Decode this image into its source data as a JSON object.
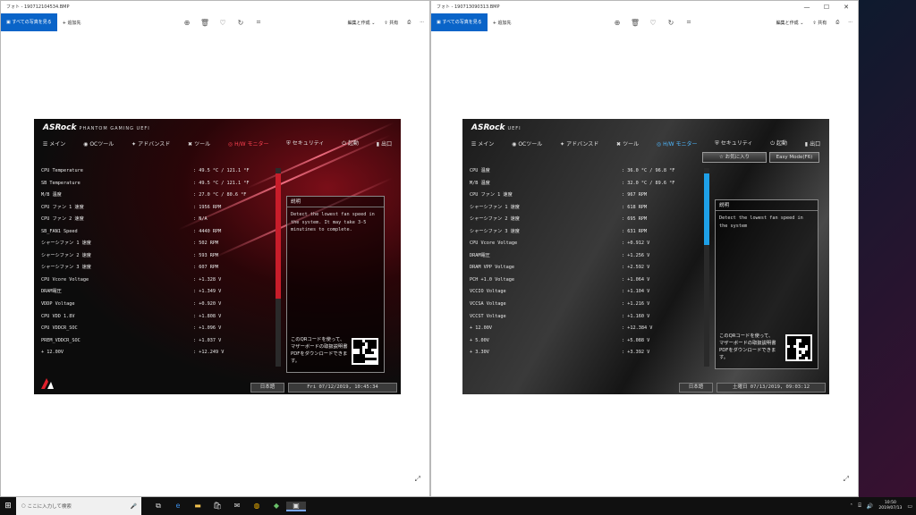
{
  "windows": [
    {
      "title": "フォト - 190712104534.BMP",
      "toolbar": {
        "all_photos": "すべての写真を見る",
        "add_to": "+ 追加先",
        "edit_create": "編集と作成",
        "share": "共有"
      }
    },
    {
      "title": "フォト - 190713090313.BMP",
      "toolbar": {
        "all_photos": "すべての写真を見る",
        "add_to": "+ 追加先",
        "edit_create": "編集と作成",
        "share": "共有"
      }
    }
  ],
  "uefi_left": {
    "logo": "ASRock",
    "logo_sub": "PHANTOM GAMING UEFI",
    "nav": [
      "メイン",
      "OCツール",
      "アドバンスド",
      "ツール",
      "H/W モニター",
      "セキュリティ",
      "起動",
      "出口"
    ],
    "rows": [
      {
        "label": "CPU Temperature",
        "value": ": 49.5 °C / 121.1 °F"
      },
      {
        "label": "SB Temperature",
        "value": ": 49.5 °C / 121.1 °F"
      },
      {
        "label": "M/B 温度",
        "value": ": 27.0 °C / 80.6 °F"
      },
      {
        "label": "CPU ファン 1 速度",
        "value": ": 1956 RPM"
      },
      {
        "label": "CPU ファン 2 速度",
        "value": ": N/A"
      },
      {
        "label": "SB_FAN1 Speed",
        "value": ": 4440 RPM"
      },
      {
        "label": "シャーシファン 1 速度",
        "value": ": 502 RPM"
      },
      {
        "label": "シャーシファン 2 速度",
        "value": ": 593 RPM"
      },
      {
        "label": "シャーシファン 3 速度",
        "value": ": 607 RPM"
      },
      {
        "label": "CPU Vcore Voltage",
        "value": ": +1.328 V"
      },
      {
        "label": "DRAM電圧",
        "value": ": +1.349 V"
      },
      {
        "label": "VDDP Voltage",
        "value": ": +0.920 V"
      },
      {
        "label": "CPU VDD 1.8V",
        "value": ": +1.808 V"
      },
      {
        "label": "CPU VDDCR_SOC",
        "value": ": +1.096 V"
      },
      {
        "label": "PREM_VDDCR_SOC",
        "value": ": +1.037 V"
      },
      {
        "label": "+ 12.00V",
        "value": ": +12.249 V"
      }
    ],
    "desc_title": "説明",
    "desc_text": "Detect the lowest fan speed in the system. It may take 3-5 minutines to complete.",
    "qr_text": "このQRコードを使って、マザーボードの取扱説明書PDFをダウンロードできます。",
    "language": "日本語",
    "datetime": "Fri 07/12/2019, 10:45:34",
    "accent": "#e0202c"
  },
  "uefi_right": {
    "logo": "ASRock",
    "logo_sub": "UEFI",
    "nav": [
      "メイン",
      "OCツール",
      "アドバンスド",
      "ツール",
      "H/W モニター",
      "セキュリティ",
      "起動",
      "出口"
    ],
    "favorite_btn": "お気に入り",
    "easy_mode_btn": "Easy Mode(F6)",
    "rows": [
      {
        "label": "CPU 温度",
        "value": ": 36.0 °C / 96.8 °F"
      },
      {
        "label": "M/B 温度",
        "value": ": 32.0 °C / 89.6 °F"
      },
      {
        "label": "CPU ファン 1 速度",
        "value": ": 967 RPM"
      },
      {
        "label": "シャーシファン 1 速度",
        "value": ": 618 RPM"
      },
      {
        "label": "シャーシファン 2 速度",
        "value": ": 695 RPM"
      },
      {
        "label": "シャーシファン 3 速度",
        "value": ": 631 RPM"
      },
      {
        "label": "CPU Vcore Voltage",
        "value": ": +0.912 V"
      },
      {
        "label": "DRAM電圧",
        "value": ": +1.256 V"
      },
      {
        "label": "DRAM VPP Voltage",
        "value": ": +2.592 V"
      },
      {
        "label": "PCH +1.0 Voltage",
        "value": ": +1.064 V"
      },
      {
        "label": "VCCIO Voltage",
        "value": ": +1.104 V"
      },
      {
        "label": "VCCSA Voltage",
        "value": ": +1.216 V"
      },
      {
        "label": "VCCST Voltage",
        "value": ": +1.160 V"
      },
      {
        "label": "+ 12.00V",
        "value": ": +12.384 V"
      },
      {
        "label": "+ 5.00V",
        "value": ": +5.088 V"
      },
      {
        "label": "+ 3.30V",
        "value": ": +3.392 V"
      }
    ],
    "desc_title": "説明",
    "desc_text": "Detect the lowest fan speed in the system",
    "qr_text": "このQRコードを使って、マザーボードの取扱説明書PDFをダウンロードできます。",
    "language": "日本語",
    "datetime": "土曜日 07/13/2019, 09:03:12",
    "accent": "#1ea0e8"
  },
  "taskbar": {
    "search_placeholder": "ここに入力して検索",
    "clock_time": "10:50",
    "clock_date": "2019/07/13"
  }
}
